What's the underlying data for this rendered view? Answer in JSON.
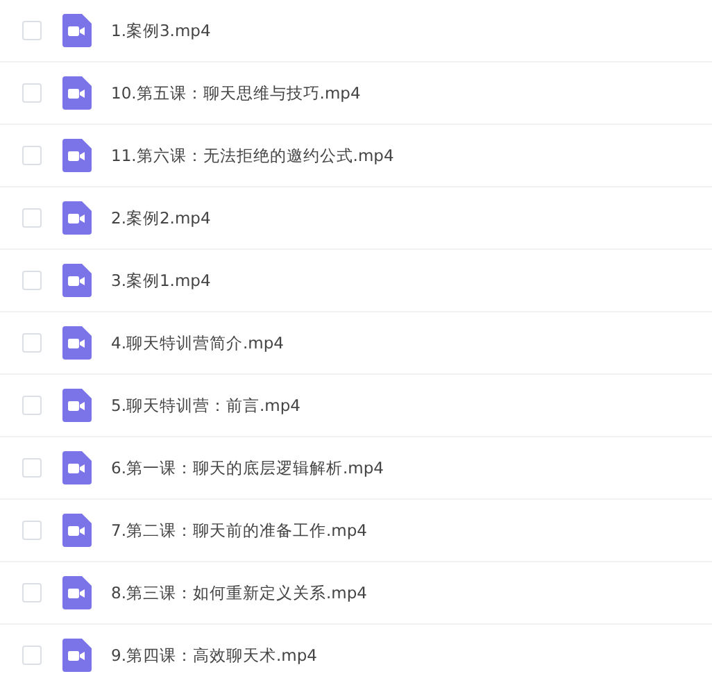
{
  "files": [
    {
      "name": "1.案例3.mp4",
      "checked": false
    },
    {
      "name": "10.第五课：聊天思维与技巧.mp4",
      "checked": false
    },
    {
      "name": "11.第六课：无法拒绝的邀约公式.mp4",
      "checked": false
    },
    {
      "name": "2.案例2.mp4",
      "checked": false
    },
    {
      "name": "3.案例1.mp4",
      "checked": false
    },
    {
      "name": "4.聊天特训营简介.mp4",
      "checked": false
    },
    {
      "name": "5.聊天特训营：前言.mp4",
      "checked": false
    },
    {
      "name": "6.第一课：聊天的底层逻辑解析.mp4",
      "checked": false
    },
    {
      "name": "7.第二课：聊天前的准备工作.mp4",
      "checked": false
    },
    {
      "name": "8.第三课：如何重新定义关系.mp4",
      "checked": false
    },
    {
      "name": "9.第四课：高效聊天术.mp4",
      "checked": false
    }
  ]
}
